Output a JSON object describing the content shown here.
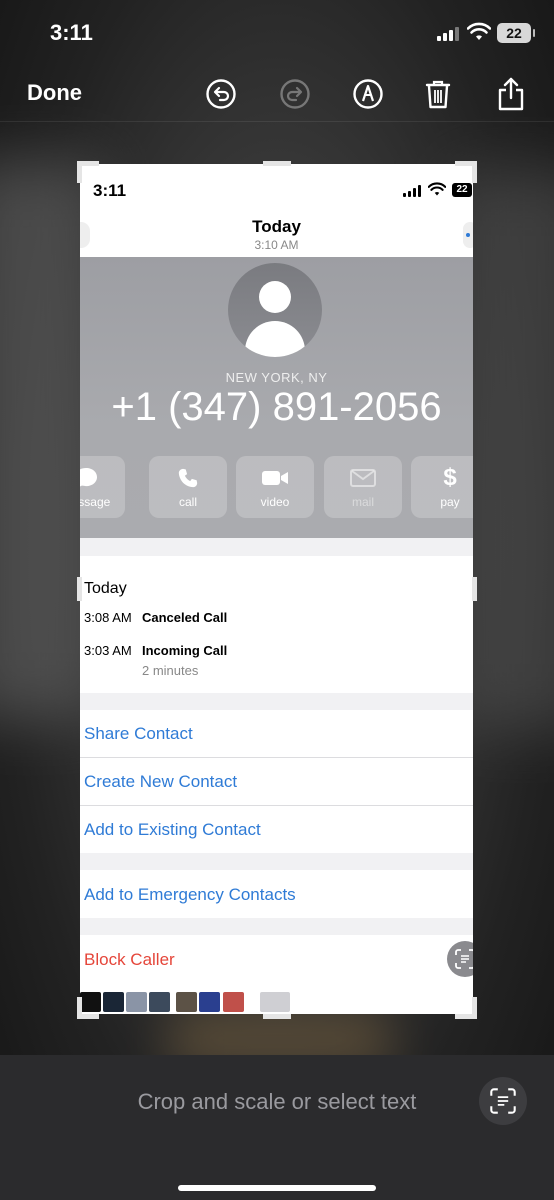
{
  "status": {
    "time": "3:11",
    "battery": "22"
  },
  "toolbar": {
    "done_label": "Done",
    "icons": [
      "undo-icon",
      "redo-icon",
      "markup-icon",
      "trash-icon",
      "share-icon"
    ]
  },
  "screenshot": {
    "status": {
      "time": "3:11",
      "battery": "22"
    },
    "header": {
      "title": "Today",
      "subtitle": "3:10 AM"
    },
    "contact": {
      "location": "NEW YORK, NY",
      "phone": "+1 (347) 891-2056"
    },
    "actions": [
      {
        "label": "message",
        "icon": "message-icon",
        "enabled": true
      },
      {
        "label": "call",
        "icon": "phone-icon",
        "enabled": true
      },
      {
        "label": "video",
        "icon": "video-icon",
        "enabled": true
      },
      {
        "label": "mail",
        "icon": "mail-icon",
        "enabled": false
      },
      {
        "label": "pay",
        "icon": "dollar-icon",
        "enabled": true
      }
    ],
    "recents": {
      "heading": "Today",
      "calls": [
        {
          "time": "3:08 AM",
          "kind": "Canceled Call",
          "detail": ""
        },
        {
          "time": "3:03 AM",
          "kind": "Incoming Call",
          "detail": "2 minutes"
        }
      ]
    },
    "options": {
      "share": "Share Contact",
      "create": "Create New Contact",
      "add_existing": "Add to Existing Contact",
      "emergency": "Add to Emergency Contacts",
      "block": "Block Caller"
    },
    "accent_color": "#2f7bd6",
    "destructive_color": "#e5463a"
  },
  "prompt": {
    "text": "Crop and scale or select text"
  }
}
